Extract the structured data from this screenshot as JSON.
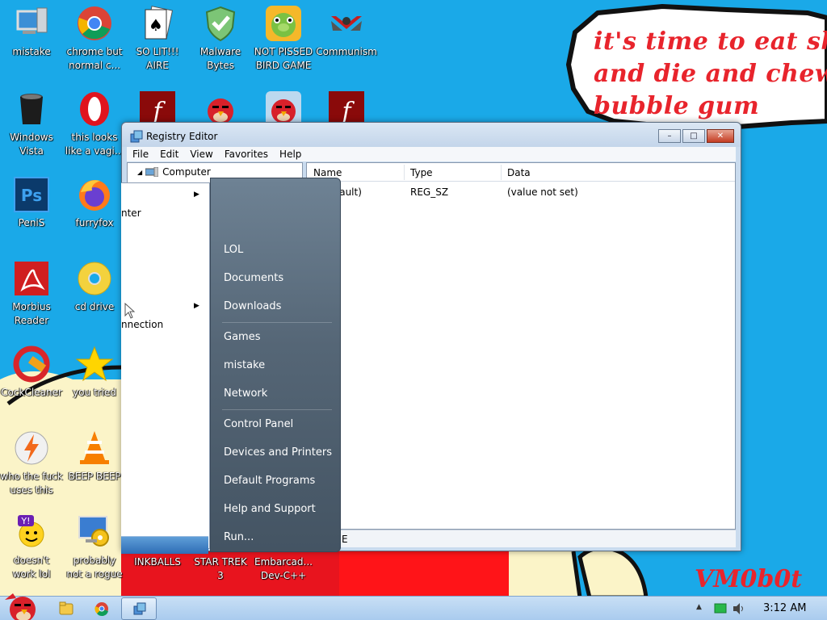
{
  "wallpaper": {
    "bubble_lines": [
      "it's time to eat shit",
      "and die and chew",
      "bubble gum"
    ],
    "watermark": "VM0b0t"
  },
  "desktop_icons": [
    {
      "label_lines": [
        "mistake"
      ],
      "icon": "computer-icon"
    },
    {
      "label_lines": [
        "chrome but",
        "normal c..."
      ],
      "icon": "chrome-icon"
    },
    {
      "label_lines": [
        "SO LIT!!!",
        "AIRE"
      ],
      "icon": "solitaire-icon"
    },
    {
      "label_lines": [
        "Malware",
        "Bytes"
      ],
      "icon": "shield-icon"
    },
    {
      "label_lines": [
        "NOT PISSED",
        "BIRD GAME"
      ],
      "icon": "pig-icon"
    },
    {
      "label_lines": [
        "Communism"
      ],
      "icon": "emblem-icon"
    },
    {
      "label_lines": [
        "Windows",
        "Vista"
      ],
      "icon": "trash-can-icon"
    },
    {
      "label_lines": [
        "this looks",
        "like a vagi..."
      ],
      "icon": "opera-icon"
    },
    {
      "label_lines": [],
      "icon": "flash-icon"
    },
    {
      "label_lines": [],
      "icon": "angry-bird-icon"
    },
    {
      "label_lines": [],
      "icon": "angry-bird-icon"
    },
    {
      "label_lines": [],
      "icon": "flash-icon"
    },
    {
      "label_lines": [
        "PeniS"
      ],
      "icon": "photoshop-icon"
    },
    {
      "label_lines": [
        "furryfox"
      ],
      "icon": "firefox-icon"
    },
    {
      "label_lines": [
        "Morbius",
        "Reader"
      ],
      "icon": "acrobat-icon"
    },
    {
      "label_lines": [
        "cd drive"
      ],
      "icon": "cd-icon"
    },
    {
      "label_lines": [
        "CockCleaner"
      ],
      "icon": "ccleaner-icon"
    },
    {
      "label_lines": [
        "you tried"
      ],
      "icon": "star-icon"
    },
    {
      "label_lines": [
        "who the fuck",
        "uses this"
      ],
      "icon": "winamp-icon"
    },
    {
      "label_lines": [
        "BEEP BEEP"
      ],
      "icon": "vlc-cone-icon"
    },
    {
      "label_lines": [
        "doesn't",
        "work lol"
      ],
      "icon": "yahoo-icon"
    },
    {
      "label_lines": [
        "probably",
        "not a rogue"
      ],
      "icon": "gears-icon"
    },
    {
      "label_lines": [
        "INKBALLS"
      ],
      "icon": "none"
    },
    {
      "label_lines": [
        "STAR TREK",
        "3"
      ],
      "icon": "none"
    },
    {
      "label_lines": [
        "Embarcad...",
        "Dev-C++"
      ],
      "icon": "none"
    }
  ],
  "regedit": {
    "title": "Registry Editor",
    "menu": [
      "File",
      "Edit",
      "View",
      "Favorites",
      "Help"
    ],
    "tree_root": "Computer",
    "columns": [
      "Name",
      "Type",
      "Data"
    ],
    "rows": [
      {
        "name": "fault)",
        "type": "REG_SZ",
        "data": "(value not set)"
      }
    ],
    "status_text": "E",
    "buttons": {
      "minimize": "–",
      "maximize": "□",
      "close": "✕"
    }
  },
  "start_menu": {
    "left_rows": [
      {
        "text": "",
        "arrow": true
      },
      {
        "text": "nter",
        "arrow": false
      },
      {
        "text": "",
        "arrow": true
      },
      {
        "text": "nnection",
        "arrow": false
      }
    ],
    "right_items": [
      "LOL",
      "Documents",
      "Downloads",
      "Games",
      "mistake",
      "Network",
      "Control Panel",
      "Devices and Printers",
      "Default Programs",
      "Help and Support",
      "Run..."
    ]
  },
  "taskbar": {
    "clock": "3:12 AM",
    "buttons": [
      "explorer-folder-icon",
      "chrome-icon",
      "registry-editor-icon"
    ]
  }
}
